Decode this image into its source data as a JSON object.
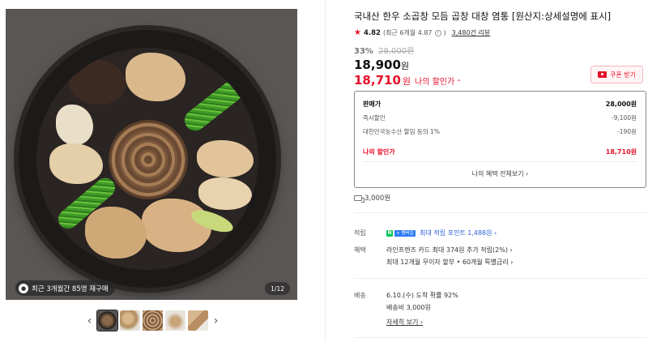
{
  "gallery": {
    "review_badge": "최근 3개월간 85명 재구매",
    "page_counter": "1/12",
    "prev_arrow": "‹",
    "next_arrow": "›",
    "thumbnail_count": 5
  },
  "product": {
    "title": "국내산 한우 소곱창 모듬 곱창 대창 염통 [원산지:상세설명에 표시]",
    "rating": "4.82",
    "rating_recent": "(최근 6개월 4.87",
    "rating_recent_close": ")",
    "review_count": "3,480건 리뷰",
    "discount_rate": "33%",
    "original_price": "28,000원",
    "price": "18,900",
    "price_unit": "원",
    "my_price": "18,710",
    "my_price_unit": "원",
    "my_price_label": "나의 할인가",
    "coupon_label": "쿠폰 받기"
  },
  "benefit_box": {
    "rows": [
      {
        "label": "판매가",
        "value": "28,000원"
      },
      {
        "label": "즉시할인",
        "value": "-9,100원"
      },
      {
        "label": "대한민국농수산 할임 등의 1%",
        "value": "-190원"
      }
    ],
    "mine": {
      "label": "나의 할인가",
      "value": "18,710원"
    },
    "footer": "나의 혜택 전체보기 ›"
  },
  "delivery_fee": "3,000원",
  "details": {
    "points_label": "적립",
    "points_badge_n": "N",
    "points_badge_plus": "+ 멤버십",
    "points_text": "최대 적립 포인트 1,488원 ›",
    "benefit_label": "혜택",
    "benefit_line1": "라인프렌즈 카드 최대 374원 추가 적립(2%) ›",
    "benefit_line2": "최대 12개월 무이자 할부 • 60개월 특별금리 ›",
    "shipping_label": "배송",
    "shipping_line1": "6.10.(수) 도착 확률 92%",
    "shipping_line2": "배송비 3,000원",
    "shipping_link": "자세히 보기 ›"
  },
  "colors": {
    "accent_red": "#e8102a",
    "point_blue": "#2d5fd6",
    "npay_green": "#03c75a"
  }
}
